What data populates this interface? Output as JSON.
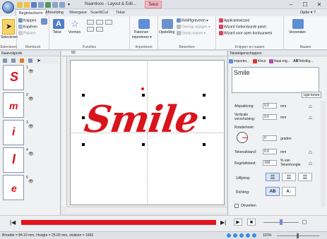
{
  "title_bar": {
    "document_title": "Naamloos - Layout & Edit...",
    "tool_tab": "Tekst",
    "minimize": "–",
    "maximize": "☐",
    "close": "✕"
  },
  "ribbon_tabs": [
    "Begintscherm",
    "Afbeelding",
    "Weergave",
    "ScanNCut",
    "Tekst"
  ],
  "options_label": "Optie ▾ ?",
  "ribbon": {
    "selecteren": {
      "big_button": "Selecteren",
      "group_label": "Selecteren"
    },
    "klembord": {
      "knippen": "Knippen",
      "kopieren": "Kopiëren",
      "plakken": "Plakken",
      "group_label": "Klembord"
    },
    "functies": {
      "tekst": "Tekst",
      "vormen": "Vormen",
      "group_label": "Functies"
    },
    "importeren": {
      "patronen": "Patronen",
      "importeren": "importeren ▾",
      "group_label": "Importeren"
    },
    "bewerken": {
      "opstelling": "Opstelling",
      "reliefgraveren": "Reliëf/graveren ▾",
      "overlap": "Overlap wijzigen ▾",
      "groep": "Groep maken ▾",
      "group_label": "Bewerken"
    },
    "knippen_naaien": {
      "applicatiewizard": "Applicatiewizard",
      "geborduurde_patch": "Wizard Geborduurde patch",
      "open_borduurwerk": "Wizard voor open borduurwerk",
      "group_label": "Knippen en naaien"
    },
    "naaien": {
      "verzenden": "Verzenden",
      "group_label": "Naaien"
    }
  },
  "left_panel": {
    "header": "Naaivolgorde",
    "items": [
      {
        "number": "1",
        "glyph": "S"
      },
      {
        "number": "2",
        "glyph": "m"
      },
      {
        "number": "3",
        "glyph": "i"
      },
      {
        "number": "4",
        "glyph": "l"
      },
      {
        "number": "5",
        "glyph": "e"
      }
    ]
  },
  "canvas": {
    "ruler_mark": "50",
    "text": "Smile"
  },
  "right_panel": {
    "header": "Teksteigenschappen",
    "toolbar": {
      "importeren": "Importer...",
      "kleur": "Kleur",
      "naai": "Naai-eig...",
      "tekstkader": "Tekstkg..."
    },
    "text_value": "Smile",
    "list_button": "Lijst tonen",
    "afspatiering": {
      "label": "Afspatiëring:",
      "value": "0.0",
      "unit": "mm"
    },
    "verschuiving": {
      "label": "Verticale verschuiving:",
      "value": "0.0",
      "unit": "mm"
    },
    "rotatiehoek": {
      "label": "Rotatiehoek:",
      "value": "0",
      "unit": "graden"
    },
    "tekenafstand": {
      "label": "Tekenafstand:",
      "value": "0.0",
      "unit": "mm"
    },
    "regelafstand": {
      "label": "Regelafstand:",
      "value": "100",
      "unit": "% van Tekenhoogte"
    },
    "uitlijning_label": "Uitlijning:",
    "richting_label": "Richting:",
    "omzetten_label": "Omzetten"
  },
  "status": {
    "text": "Breedte = 84.10 mm, Hoogte = 25.00 mm, stekken = 1666",
    "zoom": "115%"
  },
  "colors": {
    "accent_red": "#e2141b",
    "ribbon_bg": "#f6f7f9",
    "text_red": "#d8141c"
  }
}
